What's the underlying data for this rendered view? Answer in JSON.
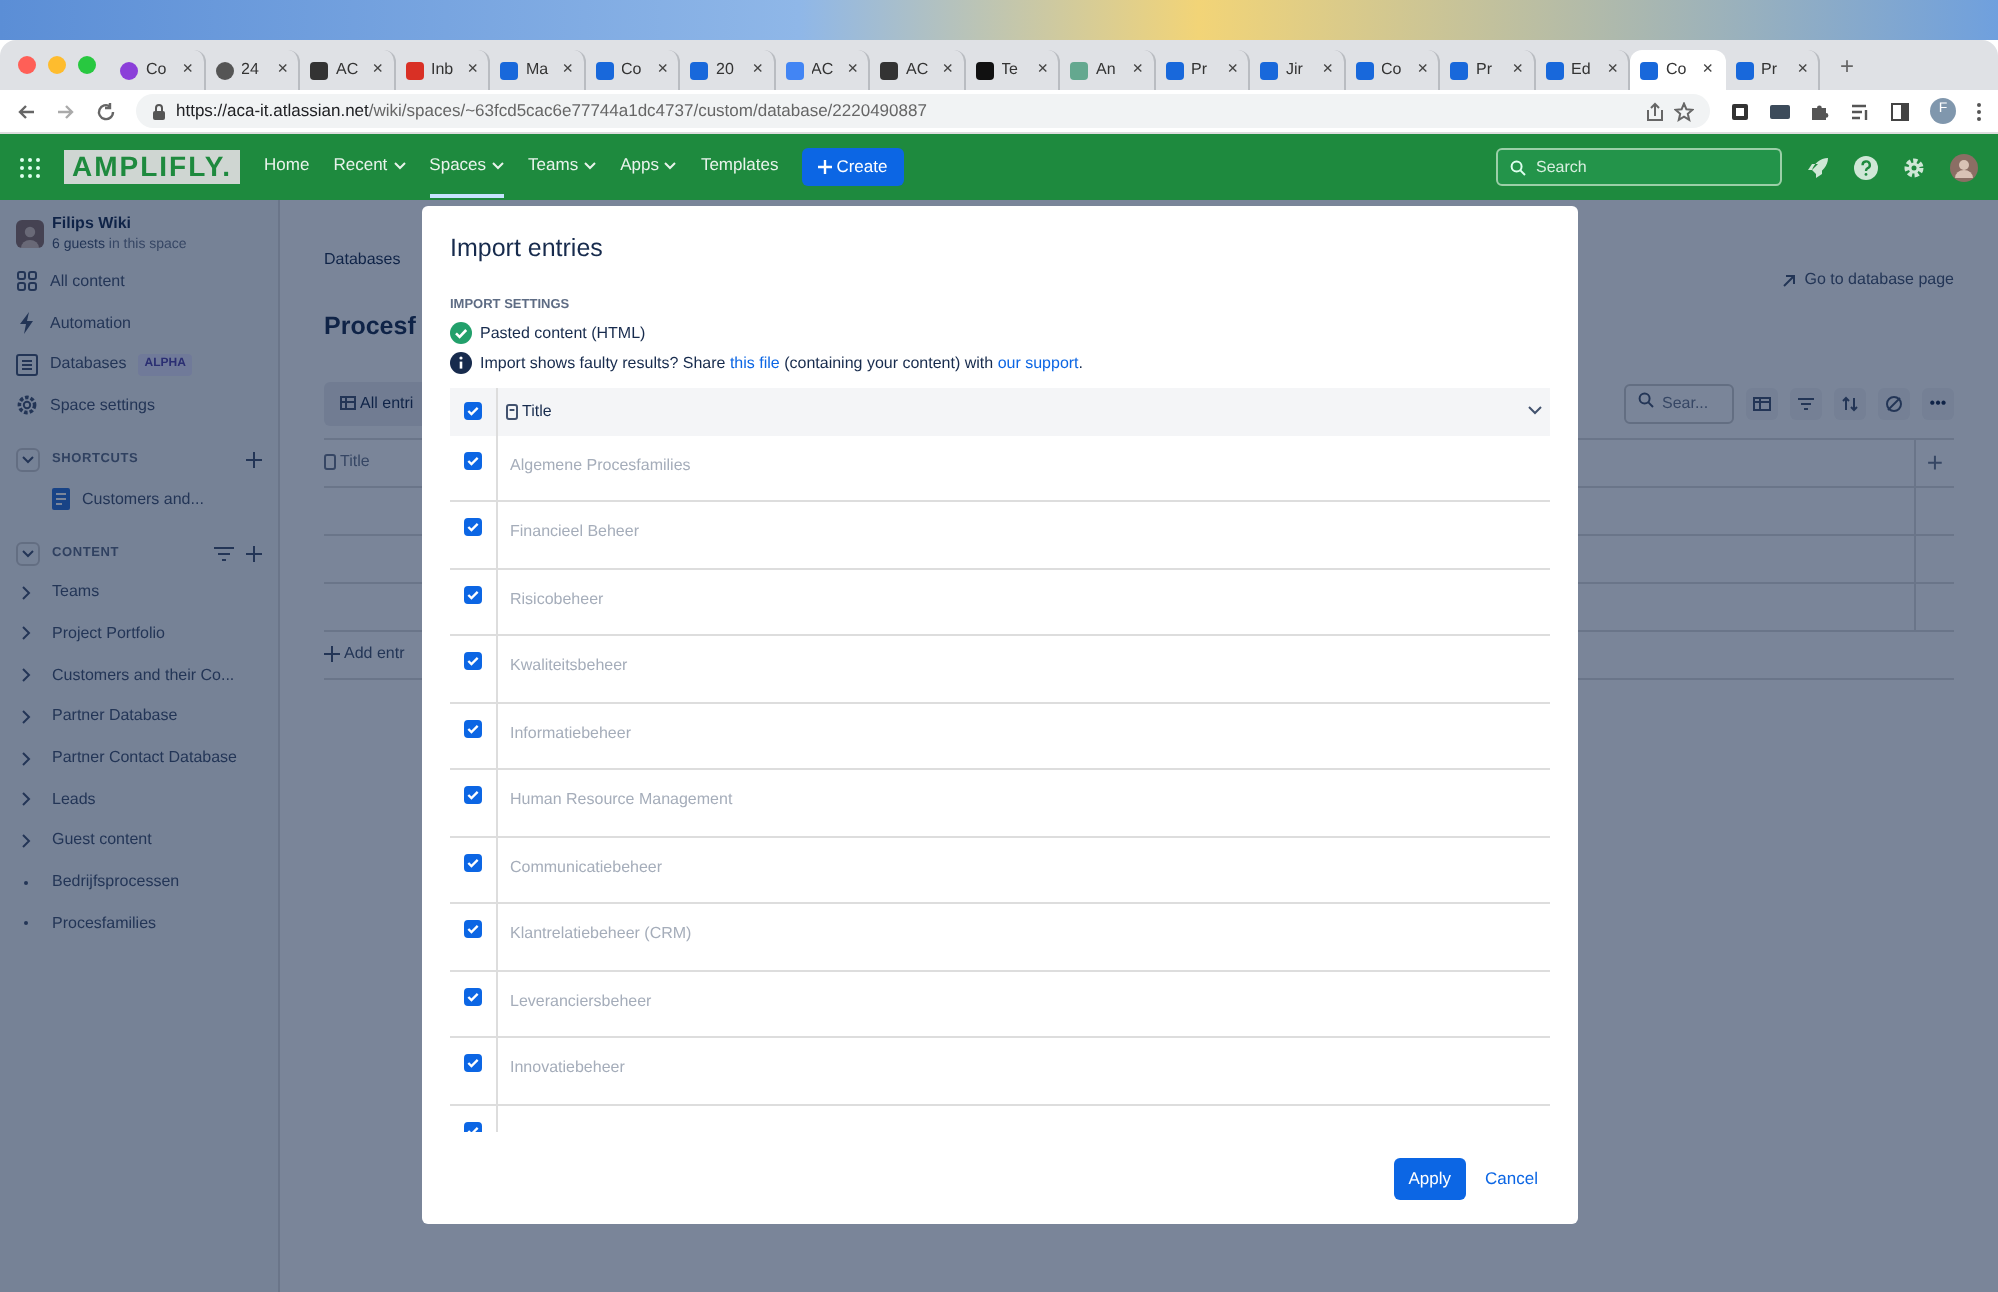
{
  "browser": {
    "tabs": [
      {
        "title": "Co",
        "selected": false
      },
      {
        "title": "24",
        "selected": false
      },
      {
        "title": "AC",
        "selected": false
      },
      {
        "title": "Inb",
        "selected": false
      },
      {
        "title": "Ma",
        "selected": false
      },
      {
        "title": "Co",
        "selected": false
      },
      {
        "title": "20",
        "selected": false
      },
      {
        "title": "AC",
        "selected": false
      },
      {
        "title": "AC",
        "selected": false
      },
      {
        "title": "Te",
        "selected": false
      },
      {
        "title": "An",
        "selected": false
      },
      {
        "title": "Pr",
        "selected": false
      },
      {
        "title": "Jir",
        "selected": false
      },
      {
        "title": "Co",
        "selected": false
      },
      {
        "title": "Pr",
        "selected": false
      },
      {
        "title": "Ed",
        "selected": false
      },
      {
        "title": "Co",
        "selected": true
      },
      {
        "title": "Pr",
        "selected": false
      }
    ],
    "close_glyph": "×",
    "new_tab_glyph": "+",
    "url_host": "https://aca-it.atlassian.net",
    "url_path": "/wiki/spaces/~63fcd5cac6e77744a1dc4737/custom/database/2220490887",
    "profile_initial": "F"
  },
  "topnav": {
    "logo": "AMPLIFLY.",
    "items": [
      {
        "label": "Home",
        "dropdown": false,
        "selected": false
      },
      {
        "label": "Recent",
        "dropdown": true,
        "selected": false
      },
      {
        "label": "Spaces",
        "dropdown": true,
        "selected": true
      },
      {
        "label": "Teams",
        "dropdown": true,
        "selected": false
      },
      {
        "label": "Apps",
        "dropdown": true,
        "selected": false
      },
      {
        "label": "Templates",
        "dropdown": false,
        "selected": false
      }
    ],
    "create": "Create",
    "search_placeholder": "Search"
  },
  "sidebar": {
    "space_name": "Filips Wiki",
    "guests_link": "6 guests",
    "guests_rest": "in this space",
    "nav": [
      {
        "label": "All content"
      },
      {
        "label": "Automation"
      },
      {
        "label": "Databases",
        "badge": "ALPHA"
      },
      {
        "label": "Space settings"
      }
    ],
    "shortcuts": {
      "heading": "SHORTCUTS",
      "items": [
        "Customers and..."
      ]
    },
    "content": {
      "heading": "CONTENT",
      "items": [
        {
          "label": "Teams",
          "has_children": true
        },
        {
          "label": "Project Portfolio",
          "has_children": true
        },
        {
          "label": "Customers and their Co...",
          "has_children": true
        },
        {
          "label": "Partner Database",
          "has_children": true
        },
        {
          "label": "Partner Contact Database",
          "has_children": true
        },
        {
          "label": "Leads",
          "has_children": true
        },
        {
          "label": "Guest content",
          "has_children": true
        },
        {
          "label": "Bedrijfsprocessen",
          "has_children": false
        },
        {
          "label": "Procesfamilies",
          "has_children": false
        }
      ]
    }
  },
  "page": {
    "breadcrumb": "Databases",
    "title": "Procesf",
    "view": "All entri",
    "column": "Title",
    "add_entry": "Add entr",
    "go_to": "Go to database page",
    "search_placeholder": "Sear...",
    "add_column": "+",
    "more": "•••"
  },
  "modal": {
    "title": "Import entries",
    "section": "IMPORT SETTINGS",
    "status": "Pasted content (HTML)",
    "info": "Import shows faulty results? Share ",
    "info_link1": "this file",
    "info_mid": " (containing your content) with ",
    "info_link2": "our support",
    "info_end": ".",
    "header_checked": true,
    "column": "Title",
    "rows": [
      {
        "title": "Algemene Procesfamilies",
        "checked": true
      },
      {
        "title": "Financieel Beheer",
        "checked": true
      },
      {
        "title": "Risicobeheer",
        "checked": true
      },
      {
        "title": "Kwaliteitsbeheer",
        "checked": true
      },
      {
        "title": "Informatiebeheer",
        "checked": true
      },
      {
        "title": "Human Resource Management",
        "checked": true
      },
      {
        "title": "Communicatiebeheer",
        "checked": true
      },
      {
        "title": "Klantrelatiebeheer (CRM)",
        "checked": true
      },
      {
        "title": "Leveranciersbeheer",
        "checked": true
      },
      {
        "title": "Innovatiebeheer",
        "checked": true
      },
      {
        "checked": true
      }
    ],
    "apply": "Apply",
    "cancel": "Cancel"
  }
}
